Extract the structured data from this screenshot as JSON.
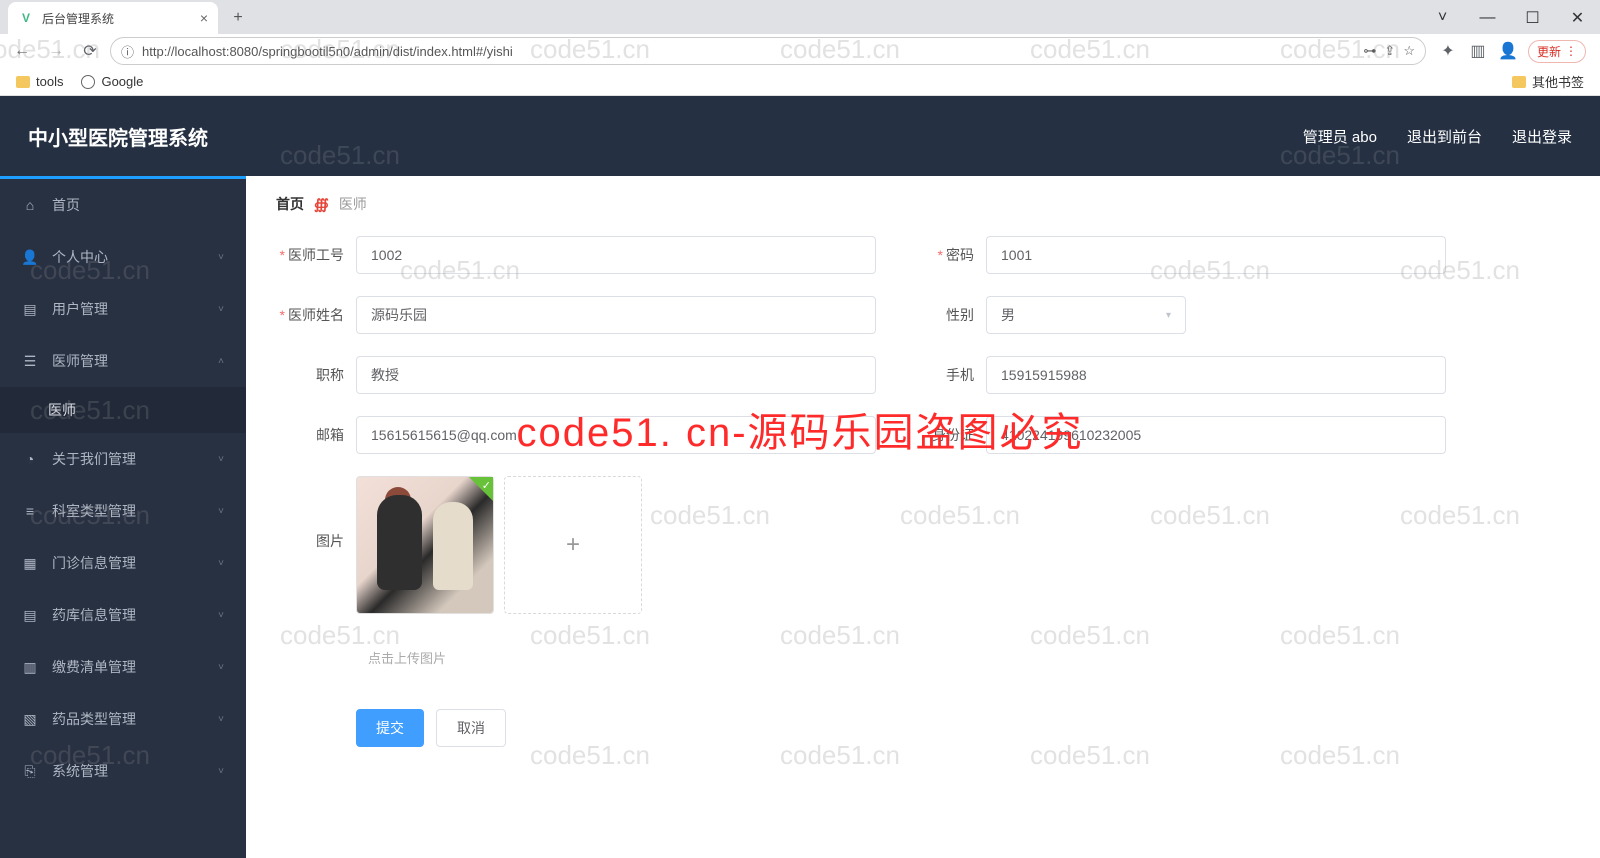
{
  "browser": {
    "tab_title": "后台管理系统",
    "url_display": "http://localhost:8080/springbootil5n0/admin/dist/index.html#/yishi",
    "update_label": "更新",
    "bookmarks": {
      "tools": "tools",
      "google": "Google",
      "other": "其他书签"
    }
  },
  "app": {
    "title": "中小型医院管理系统",
    "header_links": {
      "admin": "管理员 abo",
      "front": "退出到前台",
      "logout": "退出登录"
    }
  },
  "sidebar": {
    "home": "首页",
    "personal": "个人中心",
    "users": "用户管理",
    "doctors": "医师管理",
    "doctors_sub": "医师",
    "about": "关于我们管理",
    "dept": "科室类型管理",
    "outpatient": "门诊信息管理",
    "pharmacy": "药库信息管理",
    "payment": "缴费清单管理",
    "drugtype": "药品类型管理",
    "system": "系统管理"
  },
  "breadcrumb": {
    "home": "首页",
    "current": "医师"
  },
  "form": {
    "labels": {
      "doctor_id": "医师工号",
      "password": "密码",
      "doctor_name": "医师姓名",
      "gender": "性别",
      "title": "职称",
      "phone": "手机",
      "email": "邮箱",
      "id_card": "身份证",
      "image": "图片"
    },
    "values": {
      "doctor_id": "1002",
      "password": "1001",
      "doctor_name": "源码乐园",
      "gender": "男",
      "title": "教授",
      "phone": "15915915988",
      "email": "15615615615@qq.com",
      "id_card": "410224199610232005"
    },
    "upload_hint": "点击上传图片",
    "submit": "提交",
    "cancel": "取消"
  },
  "watermark": {
    "gray": "code51.cn",
    "red": "code51. cn-源码乐园盗图必究"
  }
}
